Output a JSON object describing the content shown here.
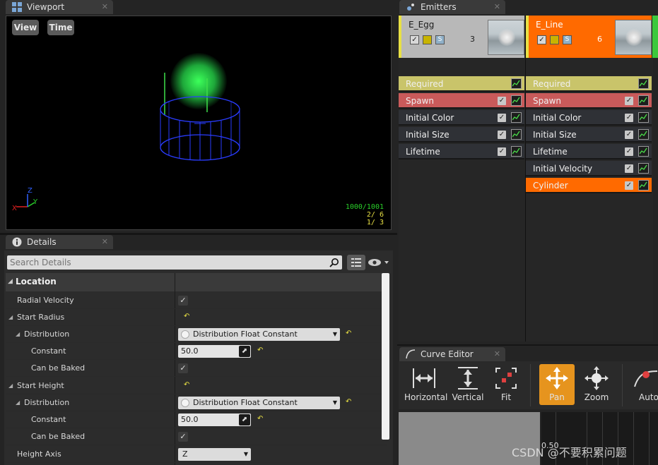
{
  "viewport": {
    "tab_title": "Viewport",
    "btn_view": "View",
    "btn_time": "Time",
    "axis_z": "Z",
    "axis_y": "Y",
    "stats": {
      "line1": "1000/1001",
      "line2": "2/  6",
      "line3": "1/  3"
    }
  },
  "emitters": {
    "tab_title": "Emitters",
    "columns": [
      {
        "name": "E_Egg",
        "count": "3",
        "mode_badge": "S",
        "modules": [
          {
            "label": "Required",
            "kind": "required"
          },
          {
            "label": "Spawn",
            "kind": "spawn"
          },
          {
            "label": "Initial Color",
            "kind": "normal"
          },
          {
            "label": "Initial Size",
            "kind": "normal"
          },
          {
            "label": "Lifetime",
            "kind": "normal"
          }
        ]
      },
      {
        "name": "E_Line",
        "count": "6",
        "mode_badge": "S",
        "modules": [
          {
            "label": "Required",
            "kind": "required"
          },
          {
            "label": "Spawn",
            "kind": "spawn"
          },
          {
            "label": "Initial Color",
            "kind": "normal"
          },
          {
            "label": "Initial Size",
            "kind": "normal"
          },
          {
            "label": "Lifetime",
            "kind": "normal"
          },
          {
            "label": "Initial Velocity",
            "kind": "normal"
          },
          {
            "label": "Cylinder",
            "kind": "selected"
          }
        ]
      }
    ]
  },
  "details": {
    "tab_title": "Details",
    "search_placeholder": "Search Details",
    "category": "Location",
    "rows": {
      "radial_velocity": "Radial Velocity",
      "start_radius": "Start Radius",
      "distribution_1": "Distribution",
      "distribution_1_value": "Distribution Float Constant",
      "constant_1": "Constant",
      "constant_1_value": "50.0",
      "can_be_baked_1": "Can be Baked",
      "start_height": "Start Height",
      "distribution_2": "Distribution",
      "distribution_2_value": "Distribution Float Constant",
      "constant_2": "Constant",
      "constant_2_value": "50.0",
      "can_be_baked_2": "Can be Baked",
      "height_axis": "Height Axis",
      "height_axis_value": "Z"
    }
  },
  "curve_editor": {
    "tab_title": "Curve Editor",
    "tools": {
      "horizontal": "Horizontal",
      "vertical": "Vertical",
      "fit": "Fit",
      "pan": "Pan",
      "zoom": "Zoom",
      "auto": "Auto"
    },
    "axis_value": "0.50"
  },
  "watermark": "CSDN @不要积累问题",
  "colors": {
    "accent_orange": "#ff6a00",
    "required_yellow": "#c9c46a",
    "spawn_red": "#c95a5a",
    "emitter_unselected": "#b8b8b8"
  }
}
